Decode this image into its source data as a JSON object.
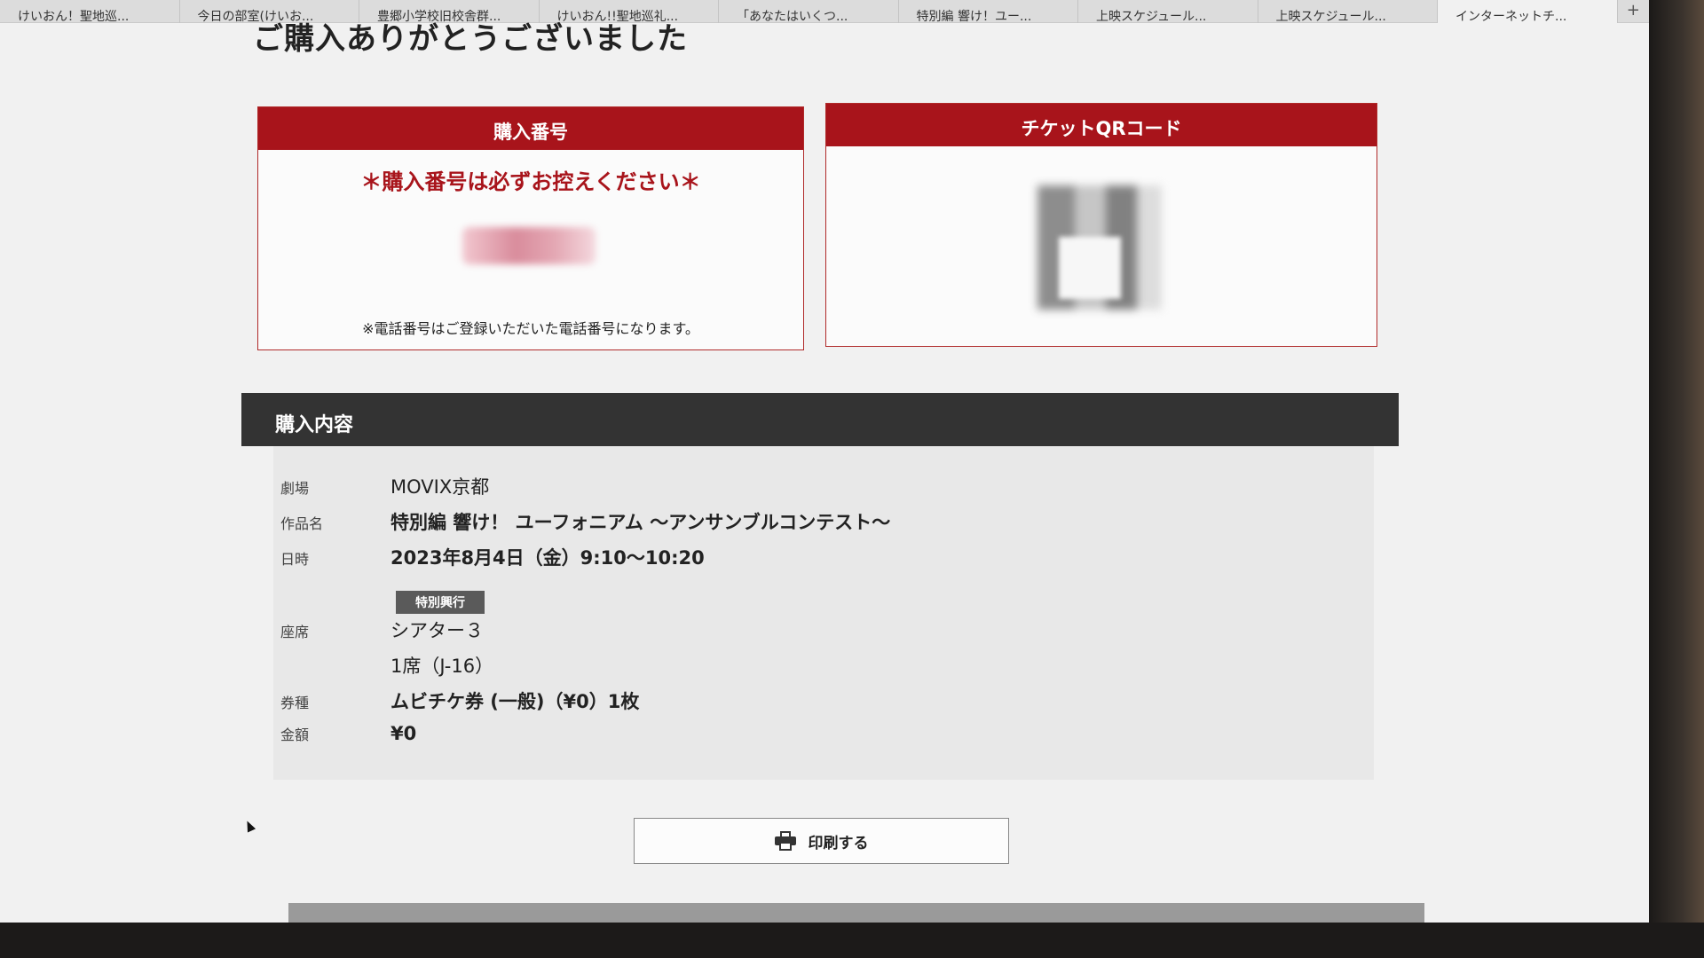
{
  "tabs": [
    "けいおん！聖地巡...",
    "今日の部室(けいお...",
    "豊郷小学校旧校舎群...",
    "けいおん!!聖地巡礼...",
    "「あなたはいくつ...",
    "特別編 響け！ユー...",
    "上映スケジュール...",
    "上映スケジュール...",
    "インターネットチ..."
  ],
  "tab_add": "+",
  "page": {
    "heading": "ご購入ありがとうございました"
  },
  "purchase_number": {
    "title": "購入番号",
    "notice": "＊購入番号は必ずお控えください＊",
    "phone_note": "※電話番号はご登録いただいた電話番号になります。"
  },
  "ticket_qr": {
    "title": "チケットQRコード"
  },
  "details": {
    "title": "購入内容",
    "theater_label": "劇場",
    "theater_value": "MOVIX京都",
    "title_label": "作品名",
    "title_value": "特別編 響け！ ユーフォニアム ～アンサンブルコンテスト～",
    "datetime_label": "日時",
    "datetime_value": "2023年8月4日（金）9:10～10:20",
    "badge": "特別興行",
    "seat_label": "座席",
    "seat_screen": "シアター３",
    "seat_value": "1席（J-16）",
    "ticket_type_label": "券種",
    "ticket_type_value": "ムビチケ券 (一般)（¥0）1枚",
    "amount_label": "金額",
    "amount_value": "¥0"
  },
  "print_button": {
    "label": "印刷する",
    "icon": "printer-icon"
  },
  "colors": {
    "accent_red": "#a8141b",
    "dark_header": "#333333"
  }
}
